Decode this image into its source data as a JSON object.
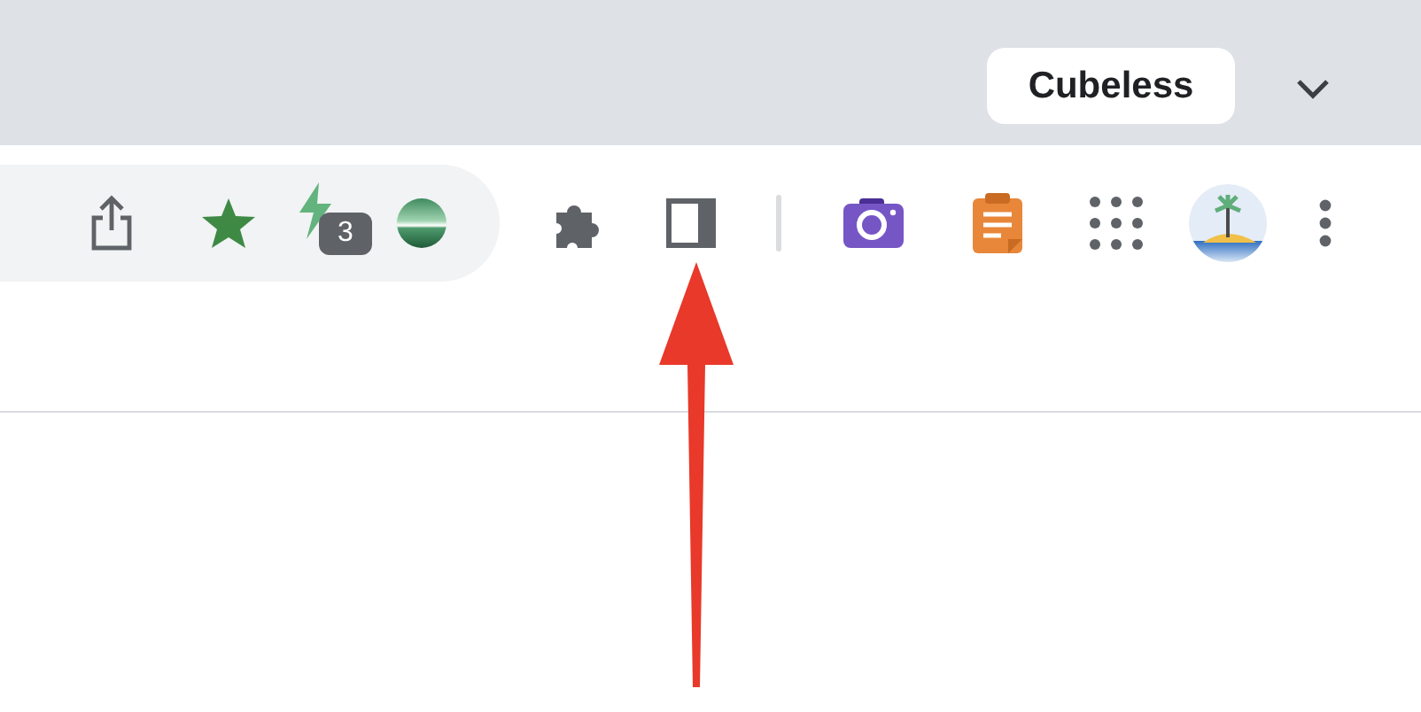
{
  "tab_strip": {
    "profile_label": "Cubeless"
  },
  "toolbar": {
    "extension_badge": "3"
  }
}
